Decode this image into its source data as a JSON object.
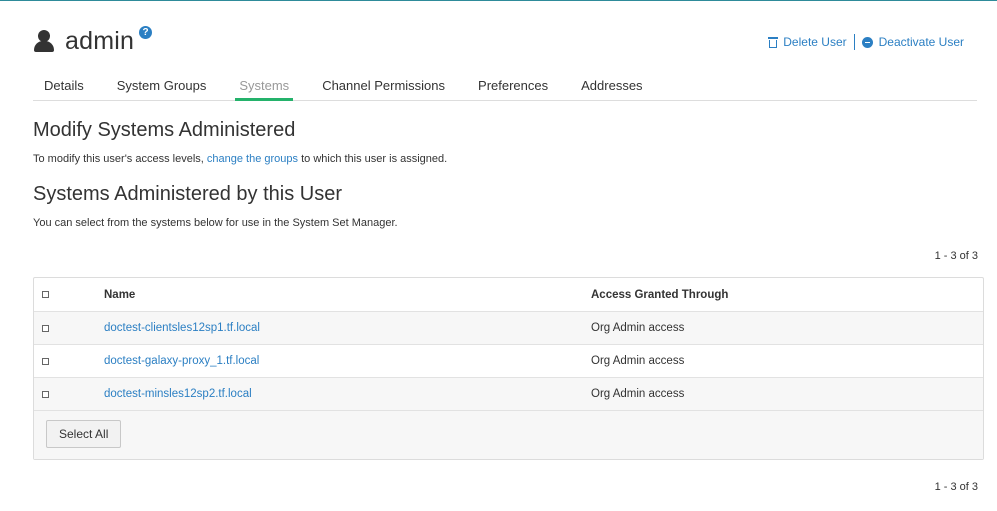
{
  "header": {
    "title": "admin",
    "help_icon": "?",
    "actions": {
      "delete": "Delete User",
      "deactivate": "Deactivate User"
    }
  },
  "tabs": [
    {
      "label": "Details"
    },
    {
      "label": "System Groups"
    },
    {
      "label": "Systems"
    },
    {
      "label": "Channel Permissions"
    },
    {
      "label": "Preferences"
    },
    {
      "label": "Addresses"
    }
  ],
  "modify": {
    "heading": "Modify Systems Administered",
    "text_before": "To modify this user's access levels, ",
    "link": "change the groups",
    "text_after": " to which this user is assigned."
  },
  "administered": {
    "heading": "Systems Administered by this User",
    "text": "You can select from the systems below for use in the System Set Manager."
  },
  "pager": {
    "top": "1 - 3 of 3",
    "bottom": "1 - 3 of 3"
  },
  "table": {
    "columns": {
      "name": "Name",
      "access": "Access Granted Through"
    },
    "rows": [
      {
        "name": "doctest-clientsles12sp1.tf.local",
        "access": "Org Admin access"
      },
      {
        "name": "doctest-galaxy-proxy_1.tf.local",
        "access": "Org Admin access"
      },
      {
        "name": "doctest-minsles12sp2.tf.local",
        "access": "Org Admin access"
      }
    ],
    "select_all": "Select All"
  },
  "colors": {
    "link": "#2b7fc3",
    "tab_active": "#24b26b"
  }
}
